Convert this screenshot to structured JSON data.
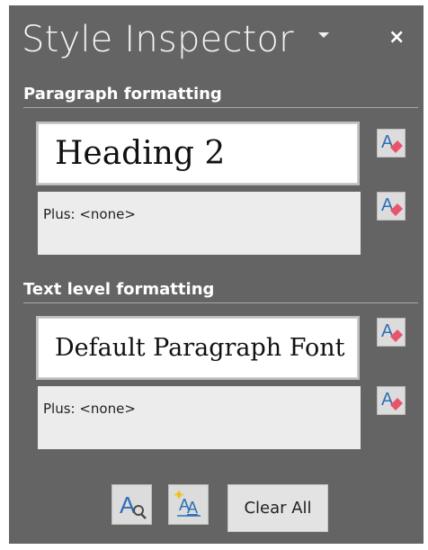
{
  "panel": {
    "title": "Style Inspector",
    "icons": {
      "dropdown": "chevron-down-icon",
      "close": "close-icon"
    },
    "close_glyph": "×"
  },
  "paragraph": {
    "label": "Paragraph formatting",
    "style_name": "Heading 2",
    "plus_text": "Plus: <none>"
  },
  "text_level": {
    "label": "Text level formatting",
    "style_name": "Default Paragraph Font",
    "plus_text": "Plus: <none>"
  },
  "footer": {
    "clear_all_label": "Clear All",
    "icons": [
      "reveal-formatting-icon",
      "new-style-icon"
    ]
  },
  "colors": {
    "pane_bg": "#646464",
    "eraser_accent": "#e8546a",
    "letter_blue": "#2e6fb7"
  }
}
